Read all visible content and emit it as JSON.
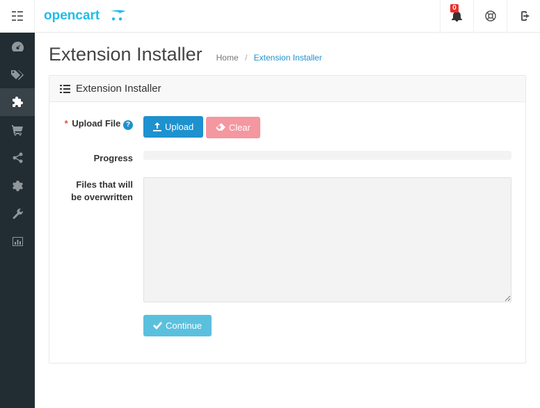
{
  "header": {
    "logo_main": "opencart",
    "notif_count": "0"
  },
  "sidebar": {
    "items": [
      {
        "name": "dashboard"
      },
      {
        "name": "catalog"
      },
      {
        "name": "extensions"
      },
      {
        "name": "sales"
      },
      {
        "name": "marketing"
      },
      {
        "name": "system"
      },
      {
        "name": "tools"
      },
      {
        "name": "reports"
      }
    ]
  },
  "page": {
    "title": "Extension Installer",
    "breadcrumb_home": "Home",
    "breadcrumb_current": "Extension Installer"
  },
  "panel": {
    "heading": "Extension Installer"
  },
  "form": {
    "upload_label": "Upload File",
    "upload_btn": "Upload",
    "clear_btn": "Clear",
    "progress_label": "Progress",
    "overwrite_label": "Files that will be overwritten",
    "continue_btn": "Continue"
  }
}
